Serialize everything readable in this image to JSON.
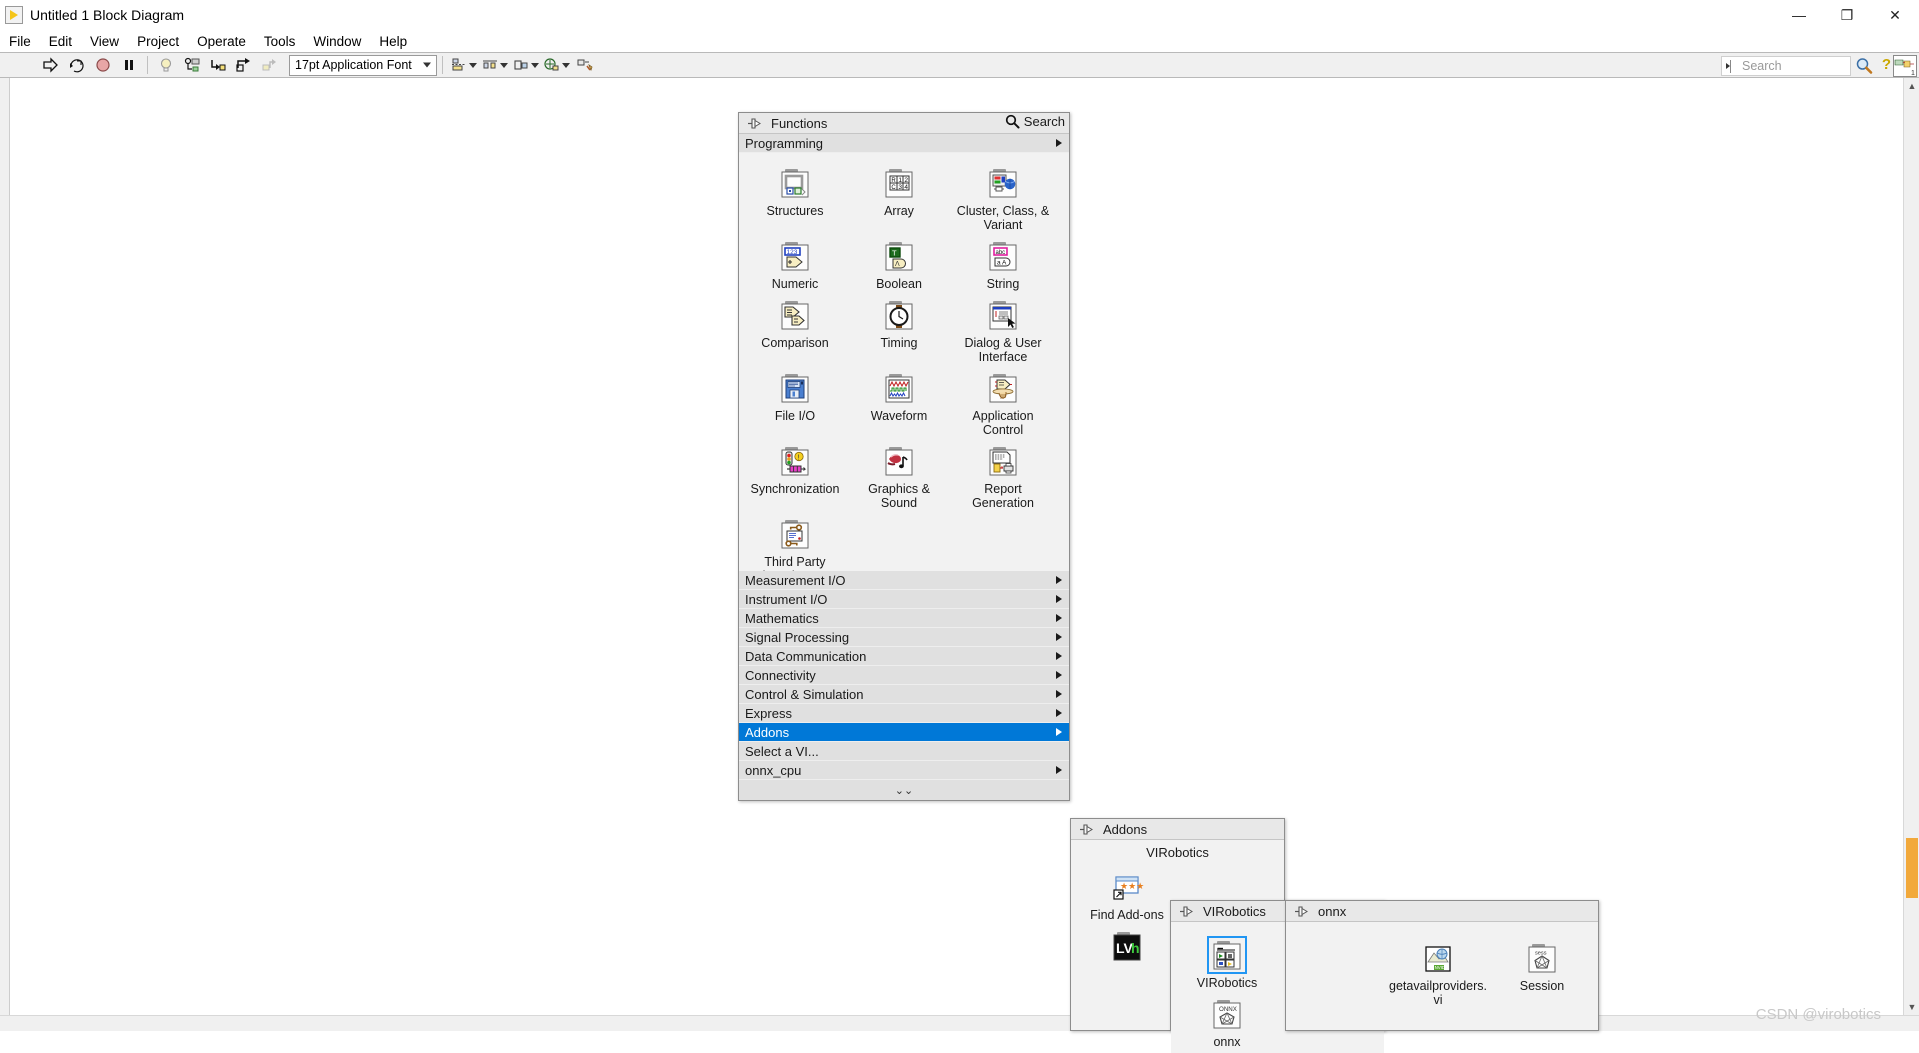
{
  "window": {
    "title": "Untitled 1 Block Diagram",
    "minimize_label": "—",
    "maximize_label": "❐",
    "close_label": "✕"
  },
  "menubar": {
    "items": [
      {
        "label": "File"
      },
      {
        "label": "Edit"
      },
      {
        "label": "View"
      },
      {
        "label": "Project"
      },
      {
        "label": "Operate"
      },
      {
        "label": "Tools"
      },
      {
        "label": "Window"
      },
      {
        "label": "Help"
      }
    ]
  },
  "toolbar": {
    "icons": [
      {
        "name": "run-arrow-icon",
        "glyph": "⇨"
      },
      {
        "name": "run-continuously-icon",
        "glyph": "⟳"
      },
      {
        "name": "abort-execution-icon",
        "glyph": "⬤"
      },
      {
        "name": "pause-icon",
        "glyph": "⏸"
      },
      {
        "name": "highlight-execution-icon",
        "glyph": "Ὂ1"
      },
      {
        "name": "retain-wire-values-icon",
        "glyph": "⚙"
      },
      {
        "name": "step-into-icon",
        "glyph": "↳"
      },
      {
        "name": "step-over-icon",
        "glyph": "↱"
      },
      {
        "name": "step-out-icon",
        "glyph": "↵"
      }
    ],
    "font_selector_value": "17pt Application Font",
    "align_objects_label": "align-objects",
    "distribute_objects_label": "distribute-objects",
    "resize_objects_label": "resize-objects",
    "reorder_label": "reorder",
    "search_placeholder": "Search",
    "help_symbol": "?"
  },
  "functions_palette": {
    "title": "Functions",
    "search_label": "Search",
    "top_category": "Programming",
    "icons": [
      {
        "label": "Structures",
        "icon": "structures-icon"
      },
      {
        "label": "Array",
        "icon": "array-icon"
      },
      {
        "label": "Cluster, Class, & Variant",
        "icon": "cluster-class-variant-icon"
      },
      {
        "label": "Numeric",
        "icon": "numeric-icon"
      },
      {
        "label": "Boolean",
        "icon": "boolean-icon"
      },
      {
        "label": "String",
        "icon": "string-icon"
      },
      {
        "label": "Comparison",
        "icon": "comparison-icon"
      },
      {
        "label": "Timing",
        "icon": "timing-icon"
      },
      {
        "label": "Dialog & User Interface",
        "icon": "dialog-user-interface-icon"
      },
      {
        "label": "File I/O",
        "icon": "file-io-icon"
      },
      {
        "label": "Waveform",
        "icon": "waveform-icon"
      },
      {
        "label": "Application Control",
        "icon": "application-control-icon"
      },
      {
        "label": "Synchronization",
        "icon": "synchronization-icon"
      },
      {
        "label": "Graphics & Sound",
        "icon": "graphics-sound-icon"
      },
      {
        "label": "Report Generation",
        "icon": "report-generation-icon"
      },
      {
        "label": "Third Party Licensing & ...",
        "icon": "third-party-licensing-icon"
      }
    ],
    "categories": [
      {
        "label": "Measurement I/O",
        "has_submenu": true,
        "selected": false
      },
      {
        "label": "Instrument I/O",
        "has_submenu": true,
        "selected": false
      },
      {
        "label": "Mathematics",
        "has_submenu": true,
        "selected": false
      },
      {
        "label": "Signal Processing",
        "has_submenu": true,
        "selected": false
      },
      {
        "label": "Data Communication",
        "has_submenu": true,
        "selected": false
      },
      {
        "label": "Connectivity",
        "has_submenu": true,
        "selected": false
      },
      {
        "label": "Control & Simulation",
        "has_submenu": true,
        "selected": false
      },
      {
        "label": "Express",
        "has_submenu": true,
        "selected": false
      },
      {
        "label": "Addons",
        "has_submenu": true,
        "selected": true
      },
      {
        "label": "Select a VI...",
        "has_submenu": false,
        "selected": false
      },
      {
        "label": "onnx_cpu",
        "has_submenu": true,
        "selected": false
      }
    ],
    "expander_glyph": "⌄⌄"
  },
  "addons_palette": {
    "title": "Addons",
    "group_label": "VIRobotics",
    "icons": [
      {
        "label": "Find Add-ons",
        "icon": "find-addons-icon"
      },
      {
        "label": "",
        "icon": "lvh-icon"
      }
    ]
  },
  "virobotics_palette": {
    "title": "VIRobotics",
    "icons": [
      {
        "label": "VIRobotics",
        "icon": "virobotics-icon",
        "selected": true
      },
      {
        "label": "onnx",
        "icon": "onnx-icon",
        "selected": false
      }
    ]
  },
  "onnx_palette": {
    "title": "onnx",
    "icons": [
      {
        "label": "getavailproviders.vi",
        "icon": "getavailproviders-icon"
      },
      {
        "label": "Session",
        "icon": "session-icon"
      }
    ]
  },
  "watermark": {
    "text": "CSDN @virobotics"
  },
  "colors": {
    "selection_blue": "#0078d7",
    "palette_bg": "#f2f2f2",
    "row_bg": "#e0e0e0",
    "scroll_thumb": "#f2a93b"
  }
}
